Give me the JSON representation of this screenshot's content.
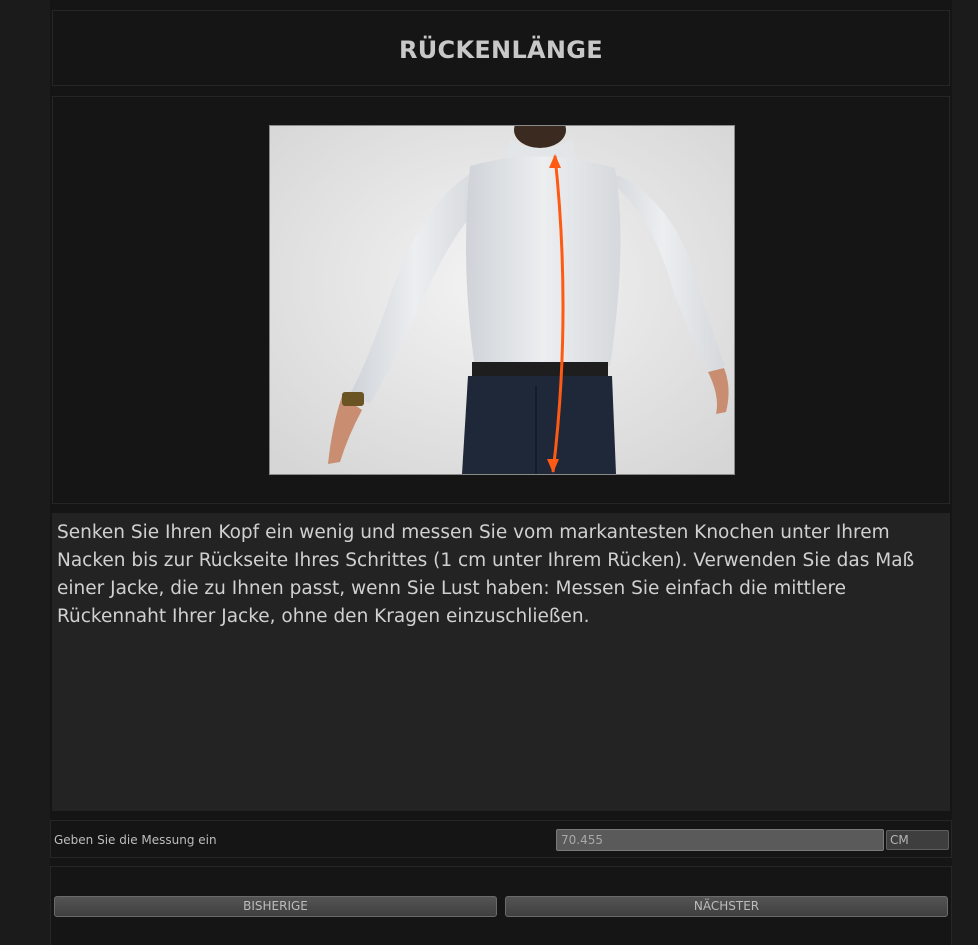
{
  "header": {
    "title": "RÜCKENLÄNGE"
  },
  "illustration": {
    "alt": "Person von hinten mit Messlinie am Rücken",
    "arrow_color": "#ff5a14"
  },
  "description": {
    "text": "Senken Sie Ihren Kopf ein wenig und messen Sie vom markantesten Knochen unter Ihrem Nacken bis zur Rückseite Ihres Schrittes (1 cm unter Ihrem Rücken). Verwenden Sie das Maß einer Jacke, die zu Ihnen passt, wenn Sie Lust haben: Messen Sie einfach die mittlere Rückennaht Ihrer Jacke, ohne den Kragen einzuschließen."
  },
  "measurement": {
    "label": "Geben Sie die Messung ein",
    "value": "70.455",
    "unit": "CM"
  },
  "navigation": {
    "previous_label": "BISHERIGE",
    "next_label": "NÄCHSTER"
  }
}
